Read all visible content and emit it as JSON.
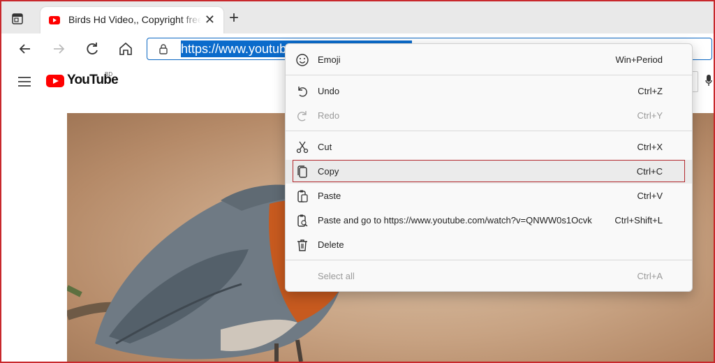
{
  "browser": {
    "tab": {
      "title": "Birds Hd Video,, Copyright free video",
      "close": "✕"
    },
    "new_tab": "+",
    "url_text": "https://www.youtub"
  },
  "youtube": {
    "logo_text": "YouTube",
    "region": "BD"
  },
  "menu": {
    "emoji": {
      "label": "Emoji",
      "shortcut": "Win+Period"
    },
    "undo": {
      "label": "Undo",
      "shortcut": "Ctrl+Z"
    },
    "redo": {
      "label": "Redo",
      "shortcut": "Ctrl+Y"
    },
    "cut": {
      "label": "Cut",
      "shortcut": "Ctrl+X"
    },
    "copy": {
      "label": "Copy",
      "shortcut": "Ctrl+C"
    },
    "paste": {
      "label": "Paste",
      "shortcut": "Ctrl+V"
    },
    "paste_go": {
      "label": "Paste and go to https://www.youtube.com/watch?v=QNWW0s1Ocvk",
      "shortcut": "Ctrl+Shift+L"
    },
    "delete": {
      "label": "Delete",
      "shortcut": ""
    },
    "select_all": {
      "label": "Select all",
      "shortcut": "Ctrl+A"
    }
  },
  "colors": {
    "accent": "#0b6bcb",
    "highlight_border": "#b3282d"
  }
}
